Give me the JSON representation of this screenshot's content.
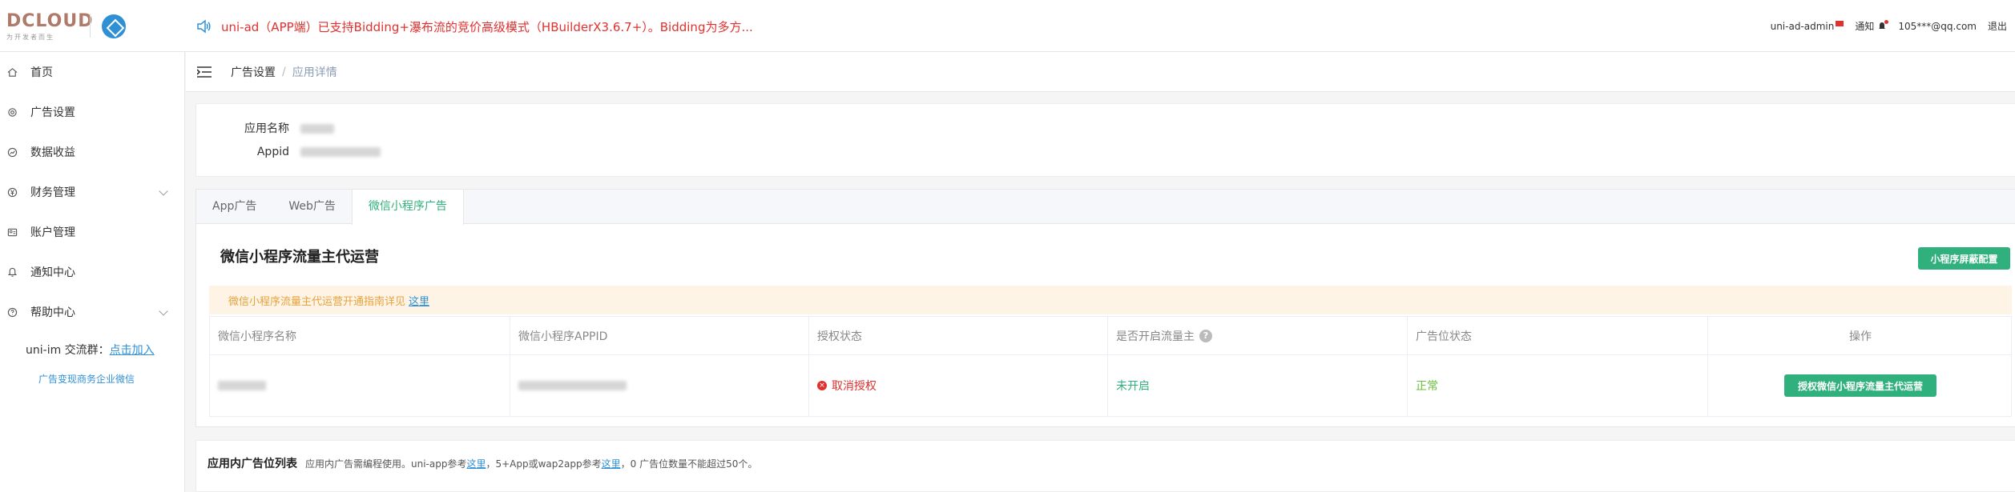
{
  "header": {
    "logo_text": "DCLOUD",
    "logo_sub": "为开发者而生",
    "notice": "uni-ad（APP端）已支持Bidding+瀑布流的竞价高级模式（HBuilderX3.6.7+）。Bidding为多方...",
    "admin_label": "uni-ad-admin",
    "notify_label": "通知",
    "user_email": "105***@qq.com",
    "exit_label": "退出"
  },
  "sidebar": {
    "items": [
      {
        "label": "首页",
        "icon": "home-icon"
      },
      {
        "label": "广告设置",
        "icon": "gear-icon"
      },
      {
        "label": "数据收益",
        "icon": "chart-icon"
      },
      {
        "label": "财务管理",
        "icon": "yen-icon"
      },
      {
        "label": "账户管理",
        "icon": "user-icon"
      },
      {
        "label": "通知中心",
        "icon": "bell-icon"
      },
      {
        "label": "帮助中心",
        "icon": "help-icon"
      }
    ],
    "im_prefix": "uni-im 交流群：",
    "im_link": "点击加入",
    "im_sub": "广告变现商务企业微信"
  },
  "breadcrumb": {
    "parent": "广告设置",
    "sep": "/",
    "current": "应用详情"
  },
  "app_info": {
    "name_label": "应用名称",
    "appid_label": "Appid"
  },
  "tabs": [
    {
      "label": "App广告"
    },
    {
      "label": "Web广告"
    },
    {
      "label": "微信小程序广告"
    }
  ],
  "wechat": {
    "title": "微信小程序流量主代运营",
    "config_button": "小程序屏蔽配置",
    "warn_text": "微信小程序流量主代运营开通指南详见",
    "warn_link": "这里",
    "columns": [
      "微信小程序名称",
      "微信小程序APPID",
      "授权状态",
      "是否开启流量主",
      "广告位状态",
      "操作"
    ],
    "help_glyph": "?",
    "row": {
      "auth_status": "取消授权",
      "traffic_status": "未开启",
      "ad_status": "正常",
      "action": "授权微信小程序流量主代运营"
    }
  },
  "ad_list": {
    "title": "应用内广告位列表",
    "desc_1": "应用内广告需编程使用。uni-app参考",
    "link_1": "这里",
    "desc_2": "，5+App或wap2app参考",
    "link_2": "这里",
    "desc_3": "，0 广告位数量不能超过50个。"
  },
  "colors": {
    "primary": "#2fb07c",
    "danger": "#e0312f",
    "link": "#2f90d6",
    "warning_bg": "#fdf4e6",
    "warning_text": "#e6a23c"
  }
}
